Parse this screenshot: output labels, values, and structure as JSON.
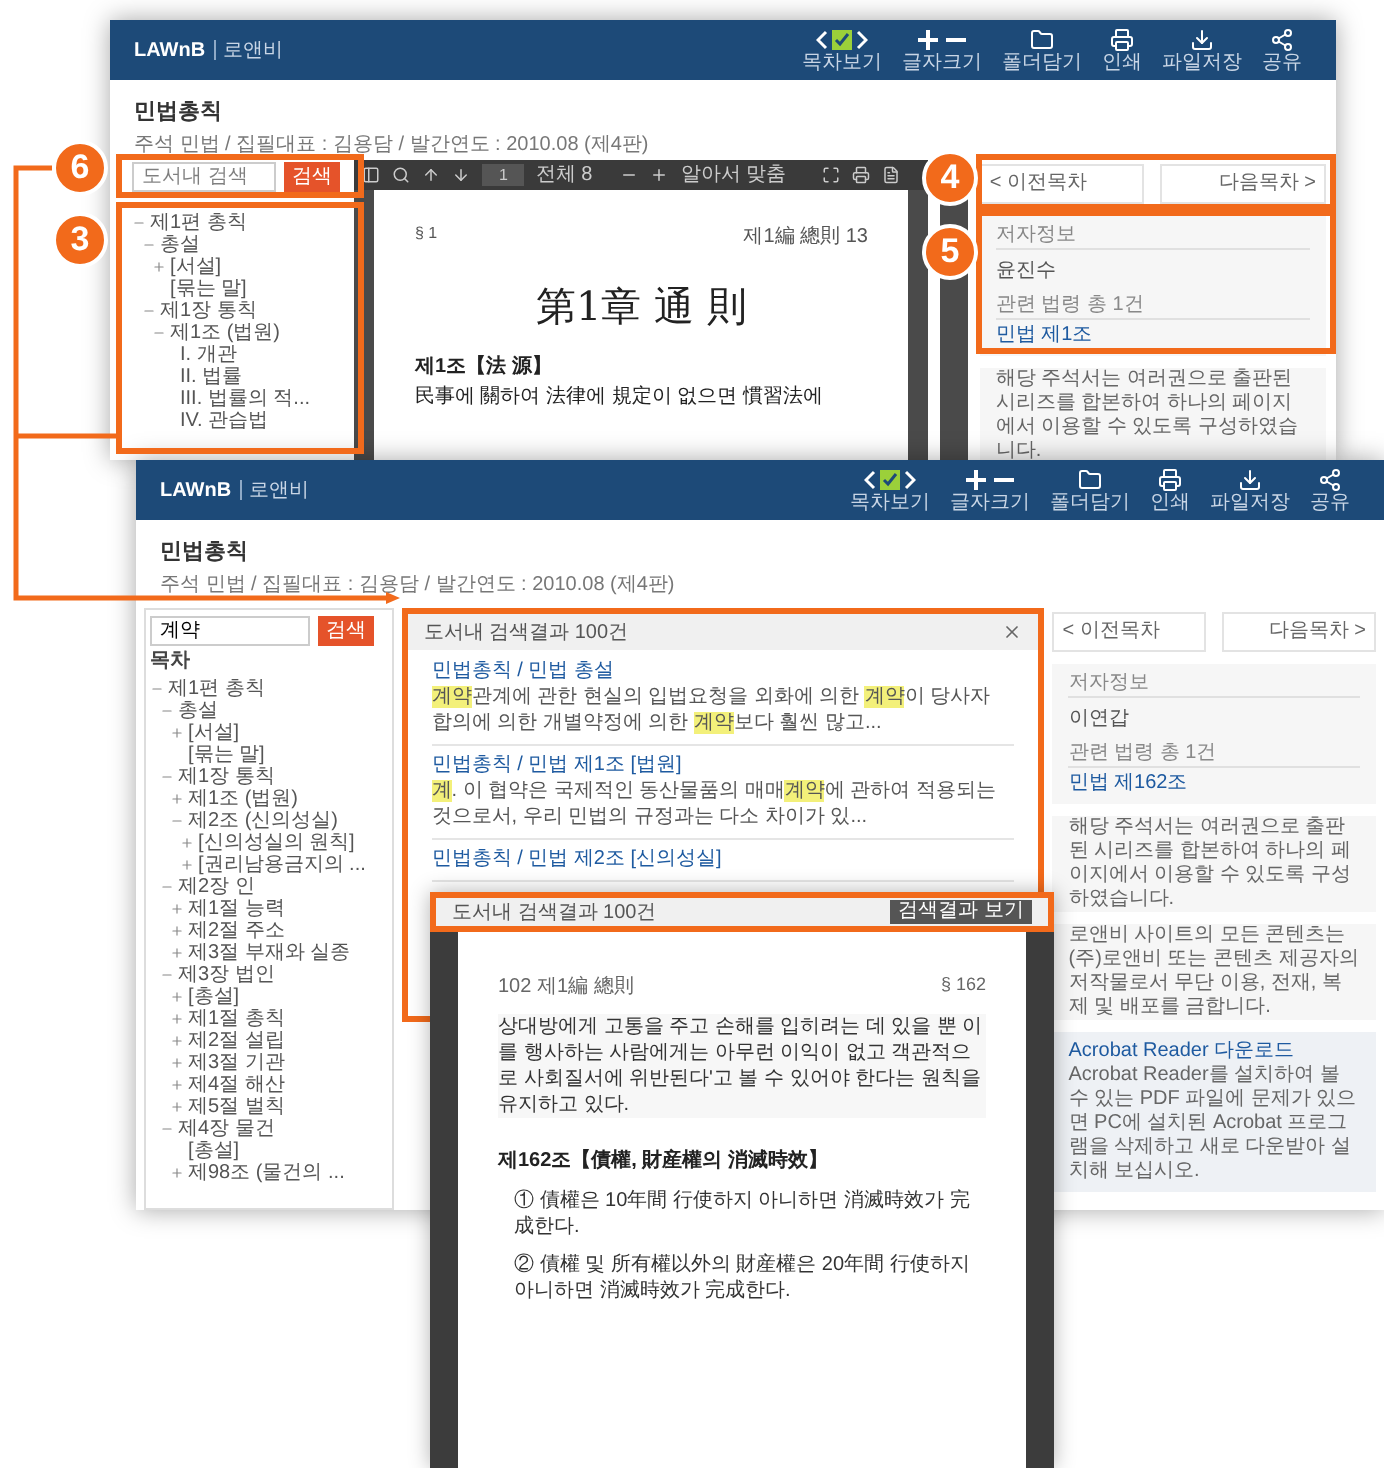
{
  "back_window": {
    "header": {
      "logo": "LAWnB",
      "service": "로앤비",
      "tools": [
        {
          "kind": "toc",
          "label": "목차보기"
        },
        {
          "kind": "zoom",
          "label": "글자크기"
        },
        {
          "kind": "folder",
          "label": "폴더담기"
        },
        {
          "kind": "print",
          "label": "인쇄"
        },
        {
          "kind": "save",
          "label": "파일저장"
        },
        {
          "kind": "share",
          "label": "공유"
        }
      ]
    },
    "title": "민법총칙",
    "meta": "주석 민법 / 집필대표 : 김용담 / 발간연도 : 2010.08 (제4판)",
    "search": {
      "placeholder": "도서내 검색",
      "button": "검색"
    },
    "toc": [
      {
        "kind": "open",
        "label": "제1편 총칙",
        "children": [
          {
            "kind": "open",
            "label": "총설",
            "children": [
              {
                "kind": "closed",
                "label": "[서설]"
              },
              {
                "kind": "leaf",
                "label": "[묶는 말]"
              }
            ]
          },
          {
            "kind": "open",
            "label": "제1장 통칙",
            "children": [
              {
                "kind": "open",
                "label": "제1조 (법원)",
                "children": [
                  {
                    "kind": "leaf",
                    "label": "I. 개관"
                  },
                  {
                    "kind": "leaf",
                    "label": "II. 법률"
                  },
                  {
                    "kind": "leaf",
                    "label": "III. 법률의 적..."
                  },
                  {
                    "kind": "leaf",
                    "label": "IV. 관습법"
                  }
                ]
              }
            ]
          }
        ]
      }
    ],
    "pdf_toolbar": {
      "page": "1",
      "total": "전체 8",
      "zoom": "알아서 맞춤"
    },
    "page": {
      "section": "§ 1",
      "running_head": "제1編 總則 13",
      "chapter": "第1章 通 則",
      "article": "제1조【法 源】",
      "text": "民事에 關하여 法律에 規定이 없으면 慣習法에"
    },
    "nav": {
      "prev": "< 이전목차",
      "next": "다음목차 >"
    },
    "author": {
      "label": "저자정보",
      "name": "윤진수"
    },
    "related": {
      "label": "관련 법령 총 1건",
      "link": "민법 제1조"
    },
    "notes": [
      "해당 주석서는 여러권으로 출판된 시리즈를 합본하여 하나의 페이지에서 이용할 수 있도록 구성하였습니다."
    ]
  },
  "front_window": {
    "header": {
      "logo": "LAWnB",
      "service": "로앤비",
      "tools": [
        {
          "kind": "toc",
          "label": "목차보기"
        },
        {
          "kind": "zoom",
          "label": "글자크기"
        },
        {
          "kind": "folder",
          "label": "폴더담기"
        },
        {
          "kind": "print",
          "label": "인쇄"
        },
        {
          "kind": "save",
          "label": "파일저장"
        },
        {
          "kind": "share",
          "label": "공유"
        }
      ]
    },
    "title": "민법총칙",
    "meta": "주석 민법 / 집필대표 : 김용담 / 발간연도 : 2010.08 (제4판)",
    "search": {
      "value": "계약",
      "button": "검색"
    },
    "toc_heading": "목차",
    "toc": [
      {
        "kind": "open",
        "label": "제1편 총칙",
        "children": [
          {
            "kind": "open",
            "label": "총설",
            "children": [
              {
                "kind": "closed",
                "label": "[서설]"
              },
              {
                "kind": "leaf",
                "label": "[묶는 말]"
              }
            ]
          },
          {
            "kind": "open",
            "label": "제1장 통칙",
            "children": [
              {
                "kind": "closed",
                "label": "제1조 (법원)"
              },
              {
                "kind": "open",
                "label": "제2조 (신의성실)",
                "children": [
                  {
                    "kind": "closed",
                    "label": "[신의성실의 원칙]"
                  },
                  {
                    "kind": "closed",
                    "label": "[권리남용금지의 ..."
                  }
                ]
              }
            ]
          },
          {
            "kind": "open",
            "label": "제2장 인",
            "children": [
              {
                "kind": "closed",
                "label": "제1절 능력"
              },
              {
                "kind": "closed",
                "label": "제2절 주소"
              },
              {
                "kind": "closed",
                "label": "제3절 부재와 실종"
              }
            ]
          },
          {
            "kind": "open",
            "label": "제3장 법인",
            "children": [
              {
                "kind": "closed",
                "label": "[총설]"
              },
              {
                "kind": "closed",
                "label": "제1절 총칙"
              },
              {
                "kind": "closed",
                "label": "제2절 설립"
              },
              {
                "kind": "closed",
                "label": "제3절 기관"
              },
              {
                "kind": "closed",
                "label": "제4절 해산"
              },
              {
                "kind": "closed",
                "label": "제5절 벌칙"
              }
            ]
          },
          {
            "kind": "open",
            "label": "제4장 물건",
            "children": [
              {
                "kind": "leaf",
                "label": "[총설]"
              },
              {
                "kind": "closed",
                "label": "제98조 (물건의 ..."
              }
            ]
          }
        ]
      }
    ],
    "popup": {
      "title": "도서내 검색결과 100건",
      "results": [
        {
          "title": "민법총칙 / 민법 총설",
          "text": "**계약**관계에 관한 현실의 입법요청을 외화에 의한 **계약**이 당사자 합의에 의한 개별약정에 의한 **계약**보다 훨씬 많고..."
        },
        {
          "title": "민법총칙 / 민법 제1조 [법원]",
          "text": "**계**. 이 협약은 국제적인 동산물품의 매매**계약**에 관하여 적용되는 것으로서, 우리 민법의 규정과는 다소 차이가 있..."
        },
        {
          "title": "민법총칙 / 민법 제2조 [신의성실]"
        }
      ]
    },
    "nav": {
      "prev": "< 이전목차",
      "next": "다음목차 >"
    },
    "author": {
      "label": "저자정보",
      "name": "이연갑"
    },
    "related": {
      "label": "관련 법령 총 1건",
      "link": "민법 제162조"
    },
    "notes": [
      "해당 주석서는 여러권으로 출판된 시리즈를 합본하여 하나의 페이지에서 이용할 수 있도록 구성하였습니다.",
      "로앤비 사이트의 모든 콘텐츠는 (주)로앤비 또는 콘텐츠 제공자의 저작물로서 무단 이용, 전재, 복제 및 배포를 금합니다."
    ],
    "acrobat": {
      "title": "Acrobat Reader 다운로드",
      "text": "Acrobat Reader를 설치하여 볼 수 있는 PDF 파일에 문제가 있으면 PC에 설치된 Acrobat 프로그램을 삭제하고 새로 다운받아 설치해 보십시오."
    }
  },
  "viewer": {
    "title": "도서내 검색결과 100건",
    "button": "검색결과 보기",
    "page": {
      "running_head": "102 제1編 總則",
      "section": "§ 162",
      "paragraph": "상대방에게 고통을 주고 손해를 입히려는 데 있을 뿐 이를 행사하는 사람에게는 아무런 이익이 없고 객관적으로 사회질서에 위반된다'고 볼 수 있어야 한다는 원칙을 유지하고 있다.",
      "article": "제162조【債權, 財産權의 消滅時效】",
      "clauses": [
        "① 債權은 10年間 行使하지 아니하면 消滅時效가 完成한다.",
        "② 債權 및 所有權以外의 財産權은 20年間 行使하지 아니하면 消滅時效가 完成한다."
      ]
    }
  },
  "callouts": [
    {
      "number": "6"
    },
    {
      "number": "3"
    },
    {
      "number": "4"
    },
    {
      "number": "5"
    }
  ]
}
